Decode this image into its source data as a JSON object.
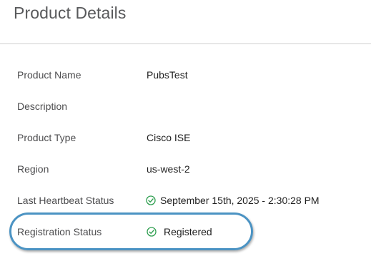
{
  "page": {
    "title": "Product Details"
  },
  "details": [
    {
      "label": "Product Name",
      "value": "PubsTest",
      "icon": ""
    },
    {
      "label": "Description",
      "value": "",
      "icon": ""
    },
    {
      "label": "Product Type",
      "value": "Cisco ISE",
      "icon": ""
    },
    {
      "label": "Region",
      "value": "us-west-2",
      "icon": ""
    },
    {
      "label": "Last Heartbeat Status",
      "value": "September 15th, 2025 - 2:30:28 PM",
      "icon": "check-circle-icon"
    },
    {
      "label": "Registration Status",
      "value": "Registered",
      "icon": "check-circle-icon"
    }
  ],
  "colors": {
    "success": "#2e9e4f",
    "highlight": "#4b93c3"
  }
}
